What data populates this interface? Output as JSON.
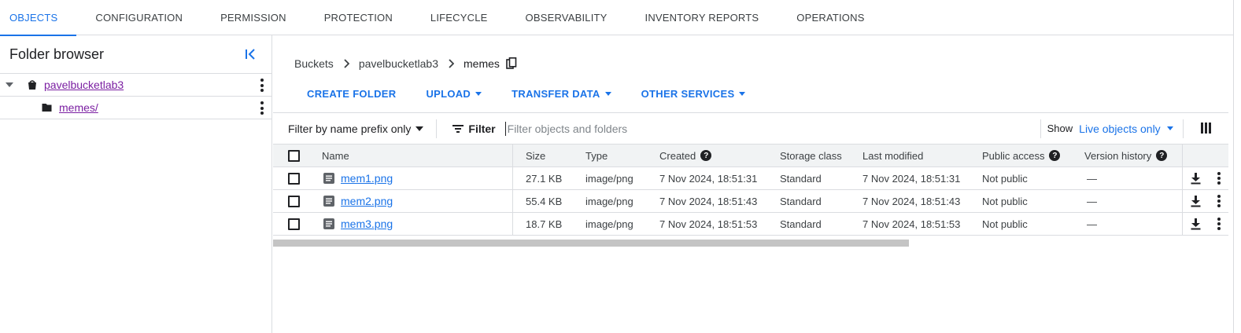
{
  "tabs": [
    {
      "label": "OBJECTS",
      "active": true
    },
    {
      "label": "CONFIGURATION"
    },
    {
      "label": "PERMISSION"
    },
    {
      "label": "PROTECTION"
    },
    {
      "label": "LIFECYCLE"
    },
    {
      "label": "OBSERVABILITY"
    },
    {
      "label": "INVENTORY REPORTS"
    },
    {
      "label": "OPERATIONS"
    }
  ],
  "sidebar": {
    "title": "Folder browser",
    "tree": [
      {
        "label": "pavelbucketlab3",
        "icon": "bucket-icon"
      },
      {
        "label": "memes/",
        "icon": "folder-icon"
      }
    ]
  },
  "breadcrumb": {
    "items": [
      "Buckets",
      "pavelbucketlab3"
    ],
    "current": "memes"
  },
  "actions": {
    "create_folder": "CREATE FOLDER",
    "upload": "UPLOAD",
    "transfer_data": "TRANSFER DATA",
    "other_services": "OTHER SERVICES"
  },
  "filterbar": {
    "prefix_mode": "Filter by name prefix only",
    "filter_label": "Filter",
    "placeholder": "Filter objects and folders",
    "show_label": "Show",
    "show_value": "Live objects only"
  },
  "table": {
    "headers": {
      "name": "Name",
      "size": "Size",
      "type": "Type",
      "created": "Created",
      "storage_class": "Storage class",
      "last_modified": "Last modified",
      "public_access": "Public access",
      "version_history": "Version history"
    },
    "rows": [
      {
        "name": "mem1.png",
        "size": "27.1 KB",
        "type": "image/png",
        "created": "7 Nov 2024, 18:51:31",
        "storage_class": "Standard",
        "last_modified": "7 Nov 2024, 18:51:31",
        "public_access": "Not public",
        "version_history": "—"
      },
      {
        "name": "mem2.png",
        "size": "55.4 KB",
        "type": "image/png",
        "created": "7 Nov 2024, 18:51:43",
        "storage_class": "Standard",
        "last_modified": "7 Nov 2024, 18:51:43",
        "public_access": "Not public",
        "version_history": "—"
      },
      {
        "name": "mem3.png",
        "size": "18.7 KB",
        "type": "image/png",
        "created": "7 Nov 2024, 18:51:53",
        "storage_class": "Standard",
        "last_modified": "7 Nov 2024, 18:51:53",
        "public_access": "Not public",
        "version_history": "—"
      }
    ]
  },
  "colors": {
    "accent": "#1a73e8",
    "visited_link": "#7b1fa2",
    "header_bg": "#f1f3f4",
    "divider": "#dadce0"
  }
}
